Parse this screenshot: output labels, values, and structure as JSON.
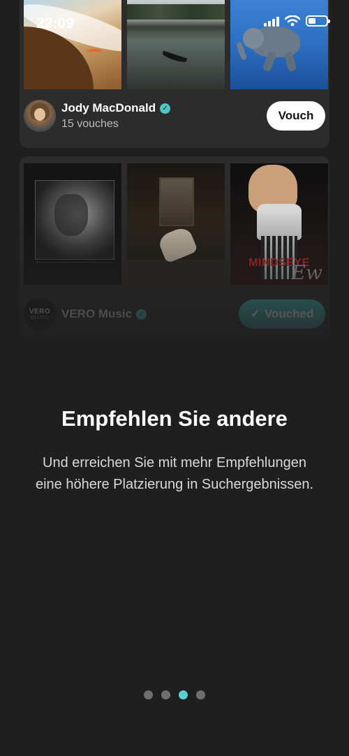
{
  "status_bar": {
    "time": "22:09",
    "icons": [
      "cellular-signal-icon",
      "wifi-icon",
      "battery-icon"
    ]
  },
  "cards": [
    {
      "photos": [
        "desert-beach-photo",
        "river-boat-photo",
        "swimming-elephant-photo"
      ],
      "name": "Jody MacDonald",
      "verified": true,
      "subtitle": "15 vouches",
      "button_label": "Vouch"
    },
    {
      "photos": [
        "album-cover-portrait",
        "album-cover-interior",
        "album-cover-singer"
      ],
      "album_text": "MINDSEYE",
      "avatar_text_top": "VERO",
      "avatar_text_bottom": "MUSIC",
      "name": "VERO Music",
      "verified": true,
      "button_label": "Vouched"
    }
  ],
  "onboarding": {
    "title": "Empfehlen Sie andere",
    "description": "Und erreichen Sie mit mehr Empfehlungen eine höhere Platzierung in Suchergebnissen."
  },
  "pagination": {
    "total": 4,
    "active_index": 2
  },
  "colors": {
    "background": "#1f1f1f",
    "card": "#2c2c2c",
    "accent": "#52c3c3",
    "vouched_button": "#3fb3b3"
  }
}
